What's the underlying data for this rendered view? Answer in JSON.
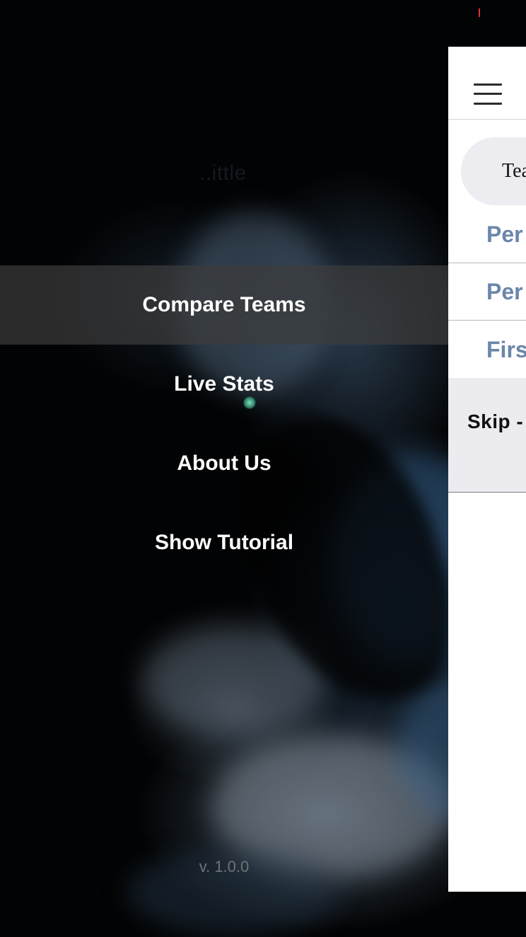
{
  "menu": {
    "items": [
      {
        "label": "Compare Teams",
        "selected": true
      },
      {
        "label": "Live Stats",
        "selected": false
      },
      {
        "label": "About Us",
        "selected": false
      },
      {
        "label": "Show Tutorial",
        "selected": false
      }
    ],
    "version": "v. 1.0.0"
  },
  "background": {
    "faded_title": "..ittle"
  },
  "main_panel": {
    "segment_label": "Tea",
    "rows": [
      "Per",
      "Per",
      "Firs"
    ],
    "skip_label": "Skip -"
  },
  "colors": {
    "menu_text": "#ffffff",
    "selected_row": "#3c3c3c",
    "row_text": "#6b86aa",
    "panel_bg": "#ffffff"
  }
}
